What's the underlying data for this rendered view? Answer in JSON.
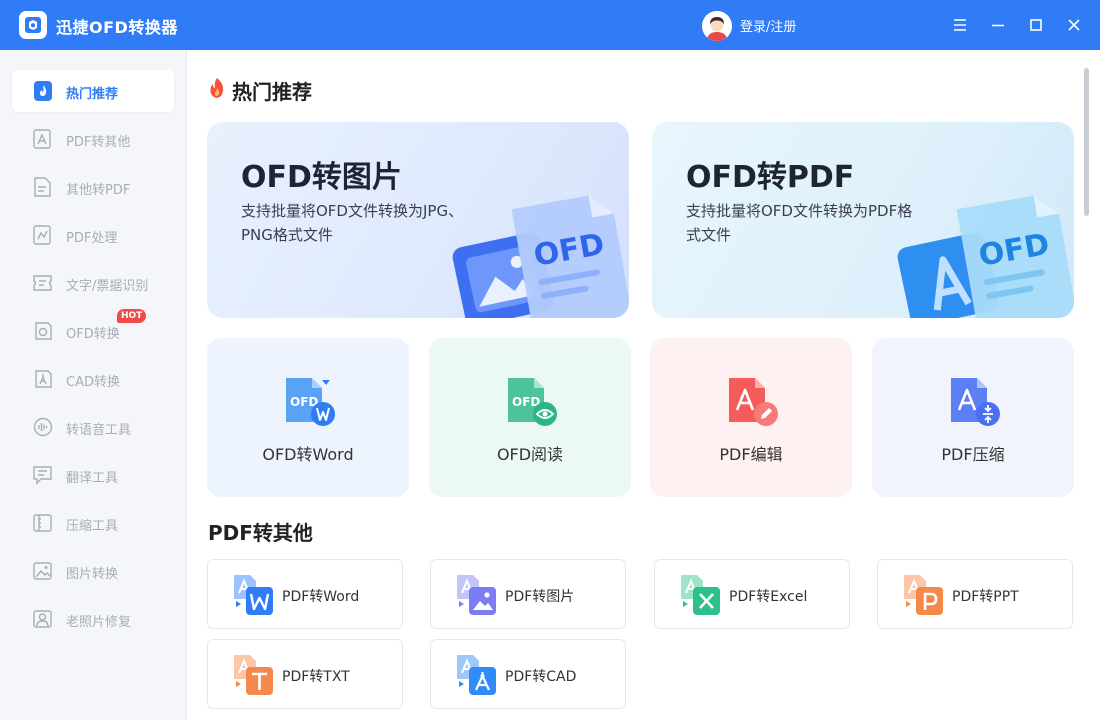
{
  "app": {
    "title": "迅捷OFD转换器",
    "login_label": "登录/注册"
  },
  "sidebar": {
    "items": [
      {
        "label": "热门推荐",
        "icon": "hot-icon",
        "active": true
      },
      {
        "label": "PDF转其他",
        "icon": "pdf-convert-icon"
      },
      {
        "label": "其他转PDF",
        "icon": "to-pdf-icon"
      },
      {
        "label": "PDF处理",
        "icon": "pdf-process-icon"
      },
      {
        "label": "文字/票据识别",
        "icon": "ocr-icon"
      },
      {
        "label": "OFD转换",
        "icon": "ofd-convert-icon",
        "badge": "HOT"
      },
      {
        "label": "CAD转换",
        "icon": "cad-icon"
      },
      {
        "label": "转语音工具",
        "icon": "voice-icon"
      },
      {
        "label": "翻译工具",
        "icon": "translate-icon"
      },
      {
        "label": "压缩工具",
        "icon": "compress-icon"
      },
      {
        "label": "图片转换",
        "icon": "image-icon"
      },
      {
        "label": "老照片修复",
        "icon": "photo-repair-icon"
      }
    ]
  },
  "main": {
    "hot_title": "热门推荐",
    "banners": [
      {
        "title": "OFD转图片",
        "desc": "支持批量将OFD文件转换为JPG、PNG格式文件"
      },
      {
        "title": "OFD转PDF",
        "desc": "支持批量将OFD文件转换为PDF格式文件"
      }
    ],
    "tools": [
      {
        "label": "OFD转Word",
        "bg": "#eef4fe"
      },
      {
        "label": "OFD阅读",
        "bg": "#ecf8f5"
      },
      {
        "label": "PDF编辑",
        "bg": "#fef1f1"
      },
      {
        "label": "PDF压缩",
        "bg": "#f1f4fd"
      }
    ],
    "pdf_title": "PDF转其他",
    "conversions": [
      {
        "label": "PDF转Word",
        "color": "#2f7cf6"
      },
      {
        "label": "PDF转图片",
        "color": "#7c7cf4"
      },
      {
        "label": "PDF转Excel",
        "color": "#2fbf8a"
      },
      {
        "label": "PDF转PPT",
        "color": "#f5894a"
      },
      {
        "label": "PDF转TXT",
        "color": "#f5894a"
      },
      {
        "label": "PDF转CAD",
        "color": "#2f8cf6"
      }
    ]
  },
  "colors": {
    "accent": "#2f7cf6",
    "hot_badge": "#f04b4b"
  }
}
